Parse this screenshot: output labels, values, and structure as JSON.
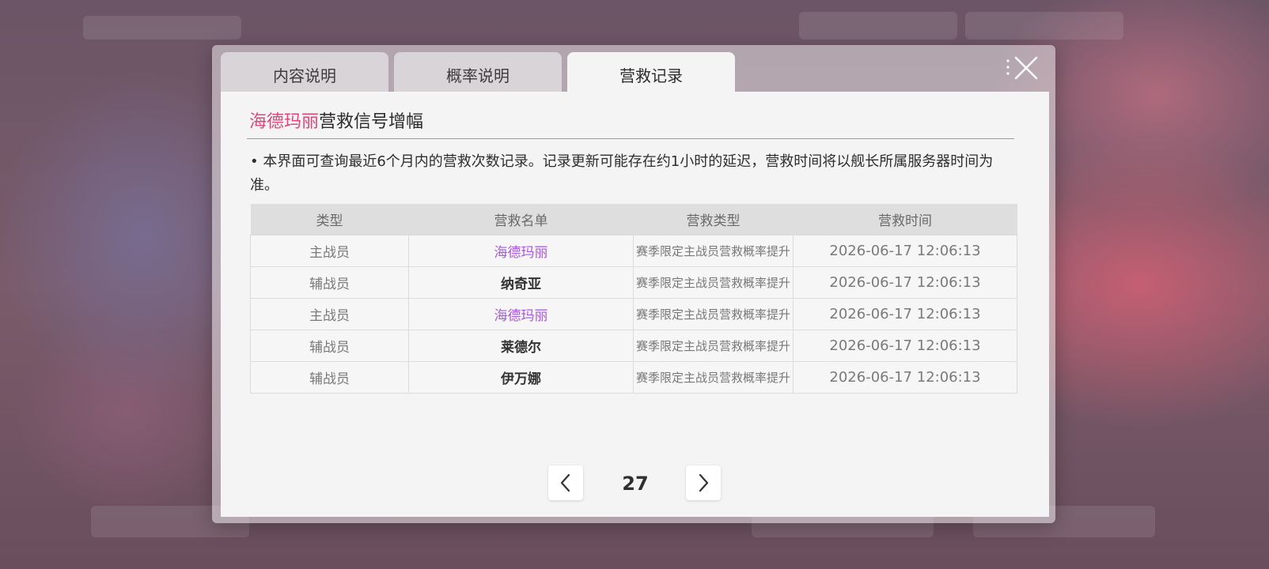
{
  "tabs": [
    {
      "label": "内容说明",
      "active": false
    },
    {
      "label": "概率说明",
      "active": false
    },
    {
      "label": "营救记录",
      "active": true
    }
  ],
  "title": {
    "highlight": "海德玛丽",
    "rest": "营救信号增幅",
    "highlight_color": "#e0457a"
  },
  "notice": "• 本界面可查询最近6个月内的营救次数记录。记录更新可能存在约1小时的延迟，营救时间将以舰长所属服务器时间为准。",
  "table": {
    "headers": [
      "类型",
      "营救名单",
      "营救类型",
      "营救时间"
    ],
    "rows": [
      {
        "type": "主战员",
        "name": "海德玛丽",
        "rescue_type": "赛季限定主战员营救概率提升",
        "time": "2026-06-17 12:06:13",
        "highlight": true
      },
      {
        "type": "辅战员",
        "name": "纳奇亚",
        "rescue_type": "赛季限定主战员营救概率提升",
        "time": "2026-06-17 12:06:13",
        "highlight": false
      },
      {
        "type": "主战员",
        "name": "海德玛丽",
        "rescue_type": "赛季限定主战员营救概率提升",
        "time": "2026-06-17 12:06:13",
        "highlight": true
      },
      {
        "type": "辅战员",
        "name": "莱德尔",
        "rescue_type": "赛季限定主战员营救概率提升",
        "time": "2026-06-17 12:06:13",
        "highlight": false
      },
      {
        "type": "辅战员",
        "name": "伊万娜",
        "rescue_type": "赛季限定主战员营救概率提升",
        "time": "2026-06-17 12:06:13",
        "highlight": false
      }
    ]
  },
  "pagination": {
    "page": "27"
  },
  "icons": {
    "close": "close-icon",
    "prev": "chevron-left-icon",
    "next": "chevron-right-icon"
  }
}
